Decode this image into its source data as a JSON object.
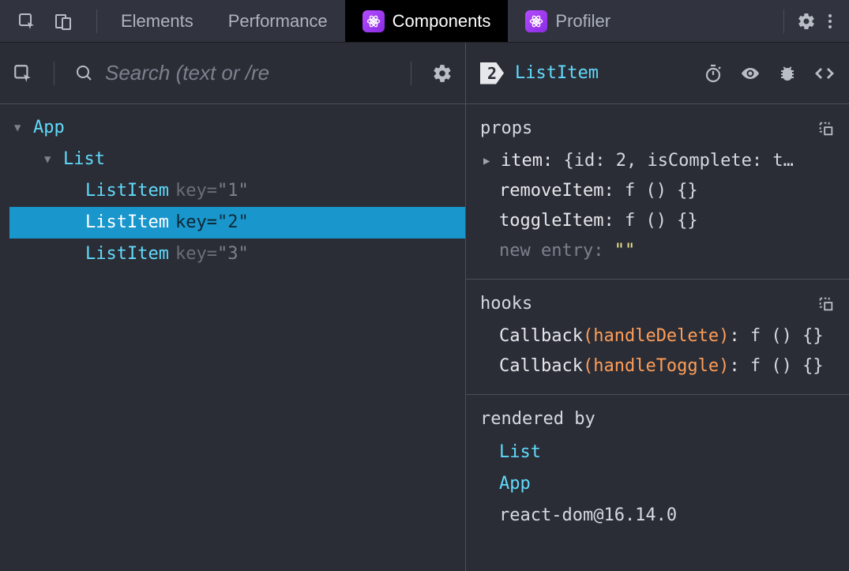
{
  "tabs": {
    "elements": "Elements",
    "performance": "Performance",
    "components": "Components",
    "profiler": "Profiler"
  },
  "search": {
    "placeholder": "Search (text or /re"
  },
  "tree": {
    "root": "App",
    "child": "List",
    "items": [
      {
        "name": "ListItem",
        "attrKey": "key",
        "attrVal": "\"1\""
      },
      {
        "name": "ListItem",
        "attrKey": "key",
        "attrVal": "\"2\""
      },
      {
        "name": "ListItem",
        "attrKey": "key",
        "attrVal": "\"3\""
      }
    ],
    "selectedIndex": 1
  },
  "detail": {
    "badge": "2",
    "title": "ListItem",
    "props": {
      "title": "props",
      "item": {
        "label": "item",
        "preview": "{id: 2, isComplete: t…"
      },
      "removeItem": {
        "label": "removeItem",
        "value": "f () {}"
      },
      "toggleItem": {
        "label": "toggleItem",
        "value": "f () {}"
      },
      "newEntry": {
        "label": "new entry",
        "value": "\"\""
      }
    },
    "hooks": {
      "title": "hooks",
      "rows": [
        {
          "label": "Callback",
          "arg": "handleDelete",
          "value": "f () {}"
        },
        {
          "label": "Callback",
          "arg": "handleToggle",
          "value": "f () {}"
        }
      ]
    },
    "rendered": {
      "title": "rendered by",
      "links": [
        "List",
        "App"
      ],
      "lib": "react-dom@16.14.0"
    }
  }
}
